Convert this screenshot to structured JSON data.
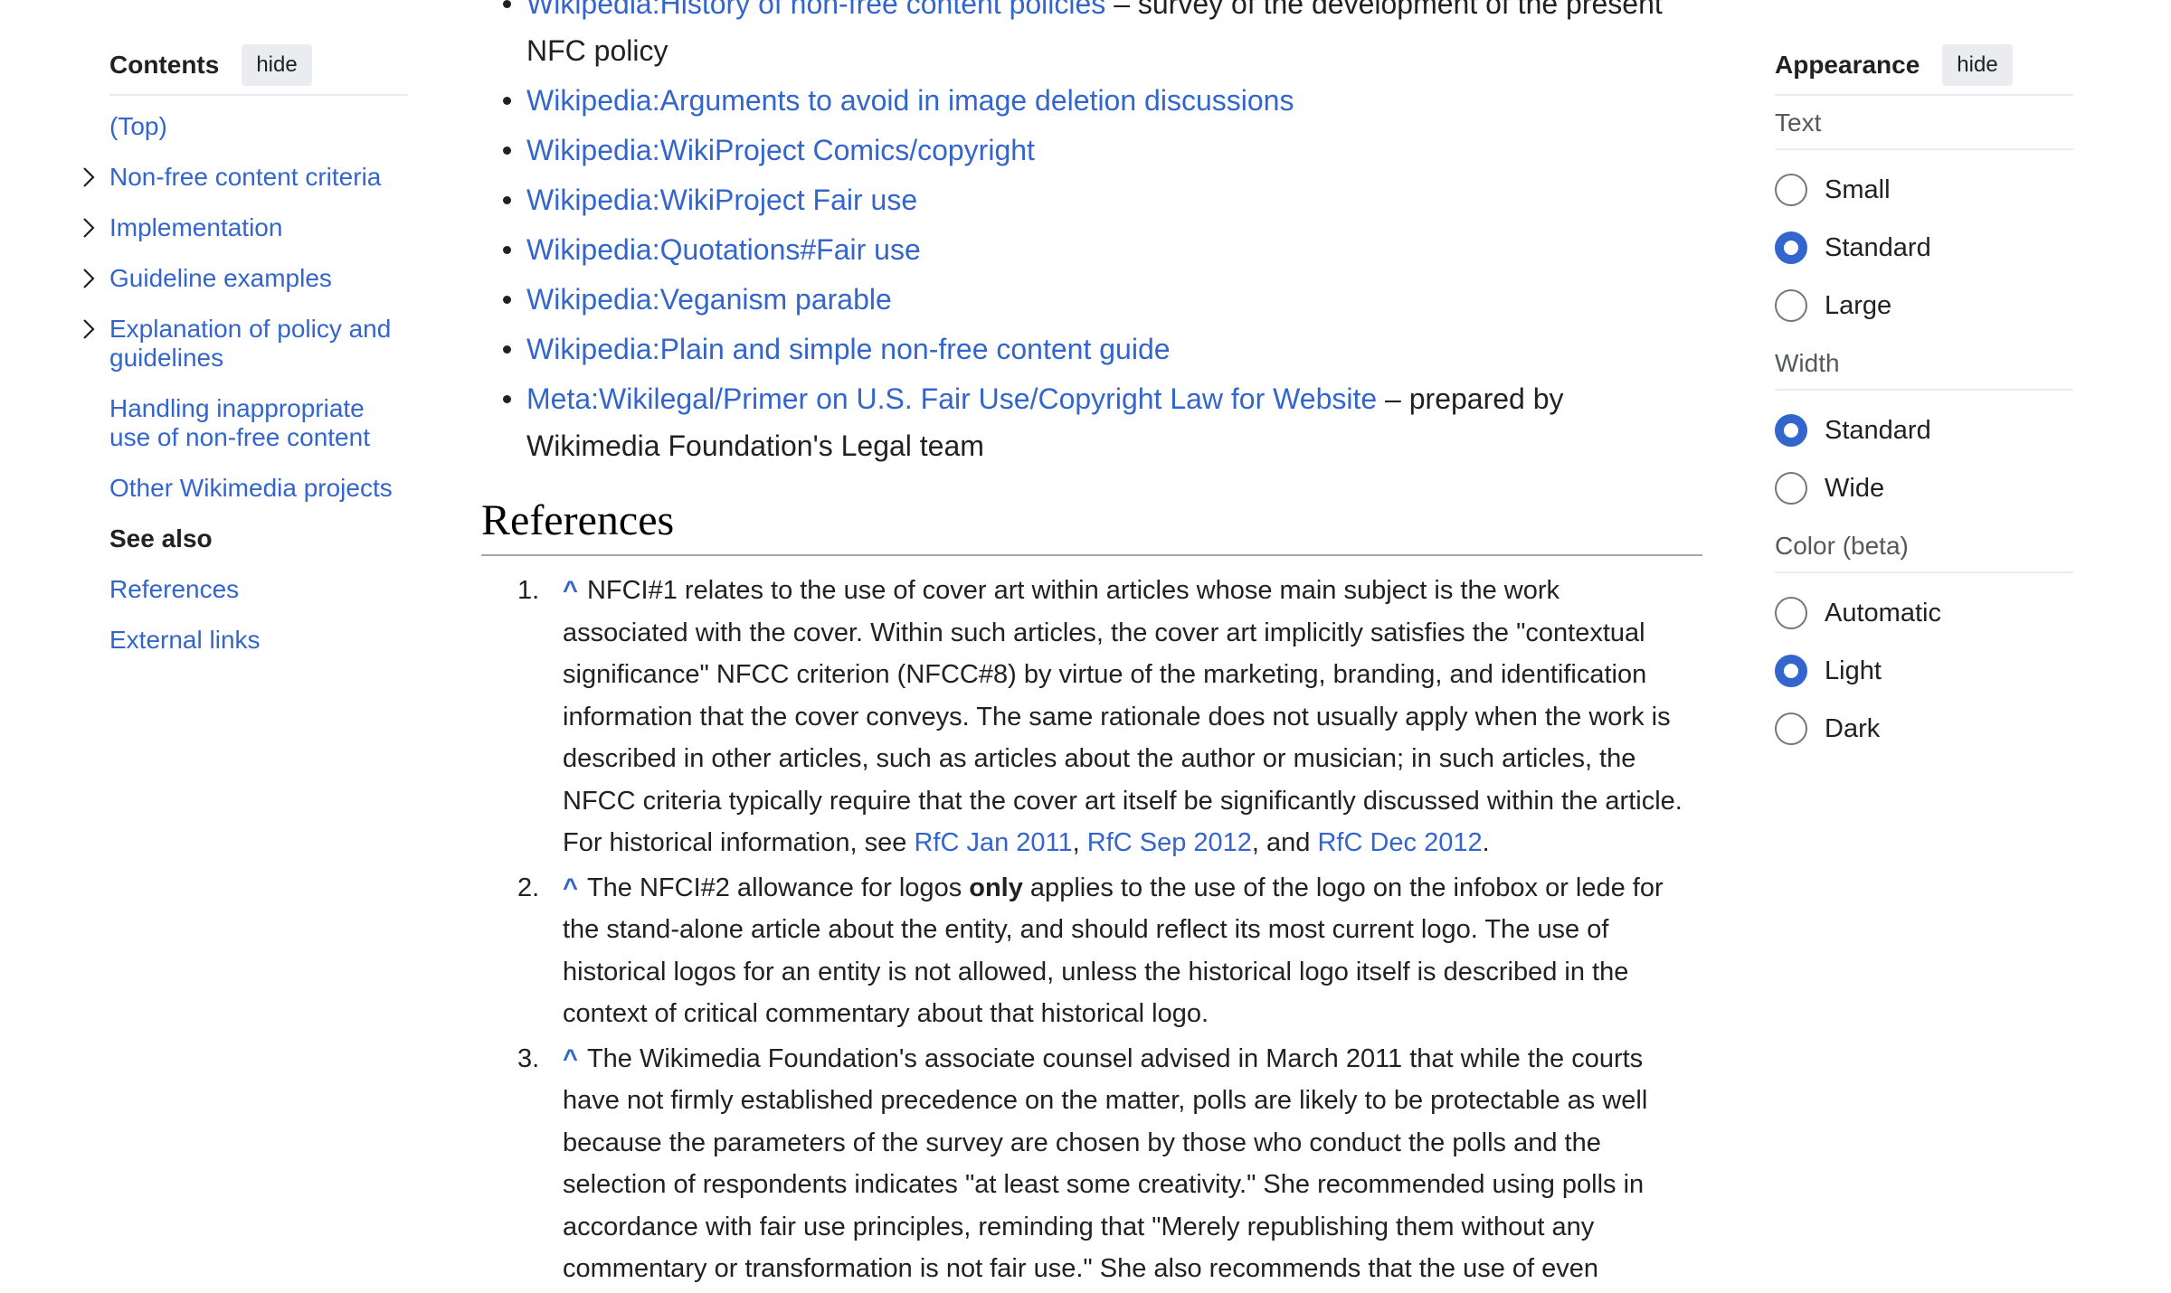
{
  "toc": {
    "title": "Contents",
    "hide_label": "hide",
    "items": [
      {
        "label": "(Top)",
        "expandable": false,
        "active": false
      },
      {
        "label": "Non-free content criteria",
        "expandable": true,
        "active": false
      },
      {
        "label": "Implementation",
        "expandable": true,
        "active": false
      },
      {
        "label": "Guideline examples",
        "expandable": true,
        "active": false
      },
      {
        "label": "Explanation of policy and guidelines",
        "expandable": true,
        "active": false
      },
      {
        "label": "Handling inappropriate use of non-free content",
        "expandable": false,
        "active": false
      },
      {
        "label": "Other Wikimedia projects",
        "expandable": false,
        "active": false
      },
      {
        "label": "See also",
        "expandable": false,
        "active": true
      },
      {
        "label": "References",
        "expandable": false,
        "active": false
      },
      {
        "label": "External links",
        "expandable": false,
        "active": false
      }
    ]
  },
  "see_also": {
    "first_item_link": "Wikipedia:History of non-free content policies",
    "first_item_text": " – survey of the development of the present NFC policy",
    "links": [
      "Wikipedia:Arguments to avoid in image deletion discussions",
      "Wikipedia:WikiProject Comics/copyright",
      "Wikipedia:WikiProject Fair use",
      "Wikipedia:Quotations#Fair use",
      "Wikipedia:Veganism parable",
      "Wikipedia:Plain and simple non-free content guide"
    ],
    "last_item_link": "Meta:Wikilegal/Primer on U.S. Fair Use/Copyright Law for Website",
    "last_item_text": " – prepared by Wikimedia Foundation's Legal team"
  },
  "references": {
    "heading": "References",
    "caret": "^",
    "ref1": {
      "num": "1.",
      "text": "NFCI#1 relates to the use of cover art within articles whose main subject is the work associated with the cover. Within such articles, the cover art implicitly satisfies the \"contextual significance\" NFCC criterion (NFCC#8) by virtue of the marketing, branding, and identification information that the cover conveys. The same rationale does not usually apply when the work is described in other articles, such as articles about the author or musician; in such articles, the NFCC criteria typically require that the cover art itself be significantly discussed within the article. For historical information, see ",
      "link1": "RfC Jan 2011",
      "sep1": ", ",
      "link2": "RfC Sep 2012",
      "sep2": ", and ",
      "link3": "RfC Dec 2012",
      "end": "."
    },
    "ref2": {
      "num": "2.",
      "text_a": "The NFCI#2 allowance for logos ",
      "bold": "only",
      "text_b": " applies to the use of the logo on the infobox or lede for the stand-alone article about the entity, and should reflect its most current logo. The use of historical logos for an entity is not allowed, unless the historical logo itself is described in the context of critical commentary about that historical logo."
    },
    "ref3": {
      "num": "3.",
      "text": "The Wikimedia Foundation's associate counsel advised in March 2011 that while the courts have not firmly established precedence on the matter, polls are likely to be protectable as well because the parameters of the survey are chosen by those who conduct the polls and the selection of respondents indicates \"at least some creativity.\" She recommended using polls in accordance with fair use principles, reminding that \"Merely republishing them without any commentary or transformation is not fair use.\" She also recommends that the use of even"
    }
  },
  "appearance": {
    "title": "Appearance",
    "hide_label": "hide",
    "text_label": "Text",
    "text_options": [
      "Small",
      "Standard",
      "Large"
    ],
    "text_selected": "Standard",
    "width_label": "Width",
    "width_options": [
      "Standard",
      "Wide"
    ],
    "width_selected": "Standard",
    "color_label": "Color (beta)",
    "color_options": [
      "Automatic",
      "Light",
      "Dark"
    ],
    "color_selected": "Light"
  },
  "colors": {
    "link": "#3366cc",
    "accent": "#3366cc",
    "text": "#202122"
  }
}
